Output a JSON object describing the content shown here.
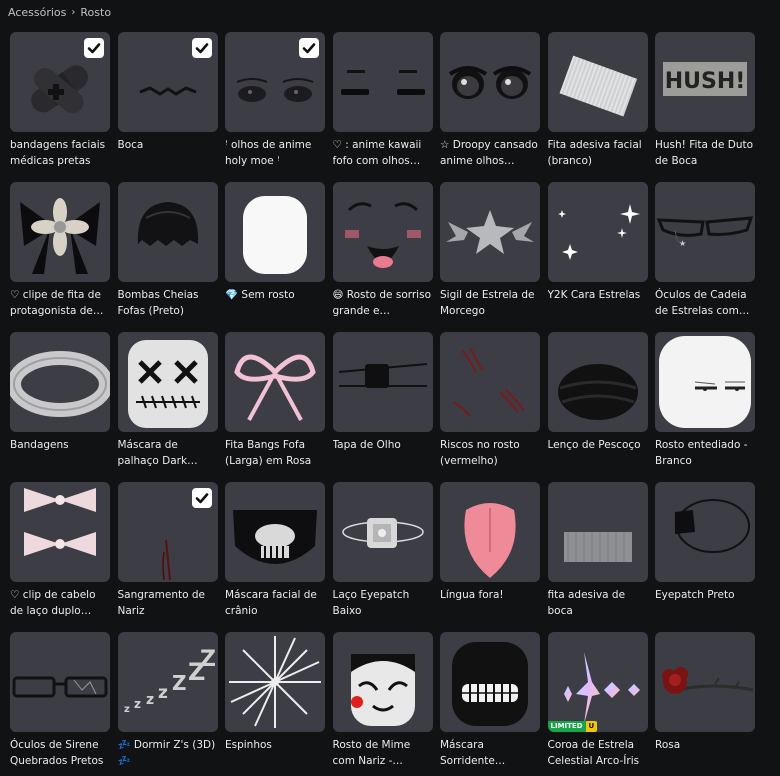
{
  "breadcrumb": {
    "parent": "Acessórios",
    "current": "Rosto"
  },
  "items": [
    {
      "name": "bandagens faciais médicas pretas",
      "checked": true
    },
    {
      "name": "Boca",
      "checked": true
    },
    {
      "name": "ꜝ olhos de anime holy moe ꜝ",
      "checked": true
    },
    {
      "name": "♡ : anime kawaii fofo com olhos…",
      "checked": false
    },
    {
      "name": "☆ Droopy cansado anime olhos pretos",
      "checked": false
    },
    {
      "name": "Fita adesiva facial (branco)",
      "checked": false
    },
    {
      "name": "Hush! Fita de Duto de Boca",
      "checked": false
    },
    {
      "name": "♡ clipe de fita de protagonista de…",
      "checked": false
    },
    {
      "name": "Bombas Cheias Fofas (Preto)",
      "checked": false
    },
    {
      "name": "💎 Sem rosto",
      "checked": false
    },
    {
      "name": "😄 Rosto de sorriso grande e…",
      "checked": false
    },
    {
      "name": "Sigil de Estrela de Morcego",
      "checked": false
    },
    {
      "name": "Y2K Cara Estrelas",
      "checked": false
    },
    {
      "name": "Óculos de Cadeia de Estrelas com…",
      "checked": false
    },
    {
      "name": "Bandagens",
      "checked": false
    },
    {
      "name": "Máscara de palhaço Dark Gla…",
      "checked": false
    },
    {
      "name": "Fita Bangs Fofa (Larga) em Rosa",
      "checked": false
    },
    {
      "name": "Tapa de Olho",
      "checked": false
    },
    {
      "name": "Riscos no rosto (vermelho)",
      "checked": false
    },
    {
      "name": "Lenço de Pescoço",
      "checked": false
    },
    {
      "name": "Rosto entediado - Branco",
      "checked": false
    },
    {
      "name": "♡ clip de cabelo de laço duplo rosa…",
      "checked": false
    },
    {
      "name": "Sangramento de Nariz",
      "checked": true
    },
    {
      "name": "Máscara facial de crânio",
      "checked": false
    },
    {
      "name": "Laço Eyepatch Baixo",
      "checked": false
    },
    {
      "name": "Língua fora!",
      "checked": false
    },
    {
      "name": "fita adesiva de boca",
      "checked": false
    },
    {
      "name": "Eyepatch Preto",
      "checked": false
    },
    {
      "name": "Óculos de Sirene Quebrados Pretos",
      "checked": false
    },
    {
      "name": "💤 Dormir Z's (3D) 💤",
      "checked": false
    },
    {
      "name": "Espinhos",
      "checked": false
    },
    {
      "name": "Rosto de Mime com Nariz -…",
      "checked": false
    },
    {
      "name": "Máscara Sorridente…",
      "checked": false
    },
    {
      "name": "Coroa de Estrela Celestial Arco-Íris",
      "checked": false,
      "badge": {
        "limited": "LIMITED",
        "u": "U"
      }
    },
    {
      "name": "Rosa",
      "checked": false
    }
  ]
}
